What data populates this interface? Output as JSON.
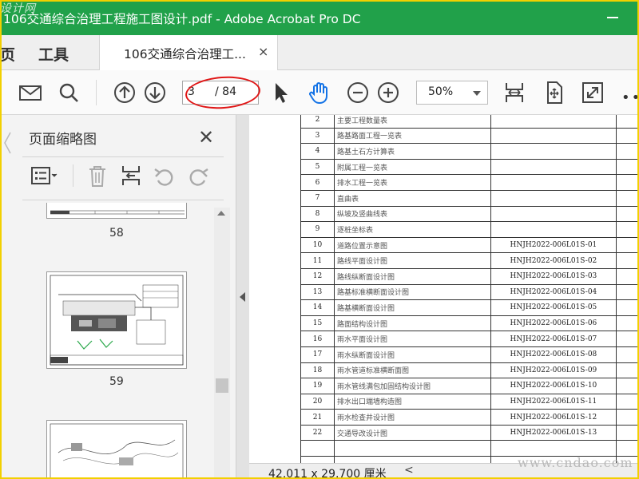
{
  "window": {
    "title": "106交通综合治理工程施工图设计.pdf - Adobe Acrobat Pro DC",
    "watermark_top": "设计网"
  },
  "tabbar": {
    "home_label": "页",
    "tools_label": "工具",
    "doc_tab_label": "106交通综合治理工...",
    "close_glyph": "×"
  },
  "toolbar": {
    "current_page": "3",
    "total_pages": "/ 84",
    "zoom": "50%",
    "more_glyph": "•••",
    "icons": [
      "mail-icon",
      "search-icon",
      "page-up-icon",
      "page-down-icon",
      "select-arrow-icon",
      "hand-tool-icon",
      "zoom-out-icon",
      "zoom-in-icon",
      "fit-width-icon",
      "fit-page-icon",
      "fullscreen-icon"
    ]
  },
  "sidebar": {
    "title": "页面缩略图",
    "close_glyph": "✕",
    "thumbnails": [
      {
        "label": "58"
      },
      {
        "label": "59"
      }
    ]
  },
  "document": {
    "rows": [
      {
        "no": "2",
        "name": "主要工程数量表",
        "code": ""
      },
      {
        "no": "3",
        "name": "路基路面工程一览表",
        "code": ""
      },
      {
        "no": "4",
        "name": "路基土石方计算表",
        "code": ""
      },
      {
        "no": "5",
        "name": "附属工程一览表",
        "code": ""
      },
      {
        "no": "6",
        "name": "排水工程一览表",
        "code": ""
      },
      {
        "no": "7",
        "name": "直曲表",
        "code": ""
      },
      {
        "no": "8",
        "name": "纵坡及竖曲线表",
        "code": ""
      },
      {
        "no": "9",
        "name": "逐桩坐标表",
        "code": ""
      },
      {
        "no": "10",
        "name": "道路位置示意图",
        "code": "HNJH2022-006L01S-01"
      },
      {
        "no": "11",
        "name": "路线平面设计图",
        "code": "HNJH2022-006L01S-02"
      },
      {
        "no": "12",
        "name": "路线纵断面设计图",
        "code": "HNJH2022-006L01S-03"
      },
      {
        "no": "13",
        "name": "路基标准横断面设计图",
        "code": "HNJH2022-006L01S-04"
      },
      {
        "no": "14",
        "name": "路基横断面设计图",
        "code": "HNJH2022-006L01S-05"
      },
      {
        "no": "15",
        "name": "路面结构设计图",
        "code": "HNJH2022-006L01S-06"
      },
      {
        "no": "16",
        "name": "雨水平面设计图",
        "code": "HNJH2022-006L01S-07"
      },
      {
        "no": "17",
        "name": "雨水纵断面设计图",
        "code": "HNJH2022-006L01S-08"
      },
      {
        "no": "18",
        "name": "雨水管道标准横断面图",
        "code": "HNJH2022-006L01S-09"
      },
      {
        "no": "19",
        "name": "雨水管线满包加固结构设计图",
        "code": "HNJH2022-006L01S-10"
      },
      {
        "no": "20",
        "name": "排水出口端墙构造图",
        "code": "HNJH2022-006L01S-11"
      },
      {
        "no": "21",
        "name": "雨水检查井设计图",
        "code": "HNJH2022-006L01S-12"
      },
      {
        "no": "22",
        "name": "交通导改设计图",
        "code": "HNJH2022-006L01S-13"
      },
      {
        "no": "",
        "name": "",
        "code": ""
      },
      {
        "no": "",
        "name": "",
        "code": ""
      }
    ]
  },
  "status": {
    "dimensions": "42.011 x 29.700 厘米",
    "scroll_left": "<"
  },
  "site_watermark": "www.cndao.com",
  "colors": {
    "title_bar": "#21a14a",
    "accent_blue": "#1473e6",
    "annotation_red": "#e01616"
  }
}
